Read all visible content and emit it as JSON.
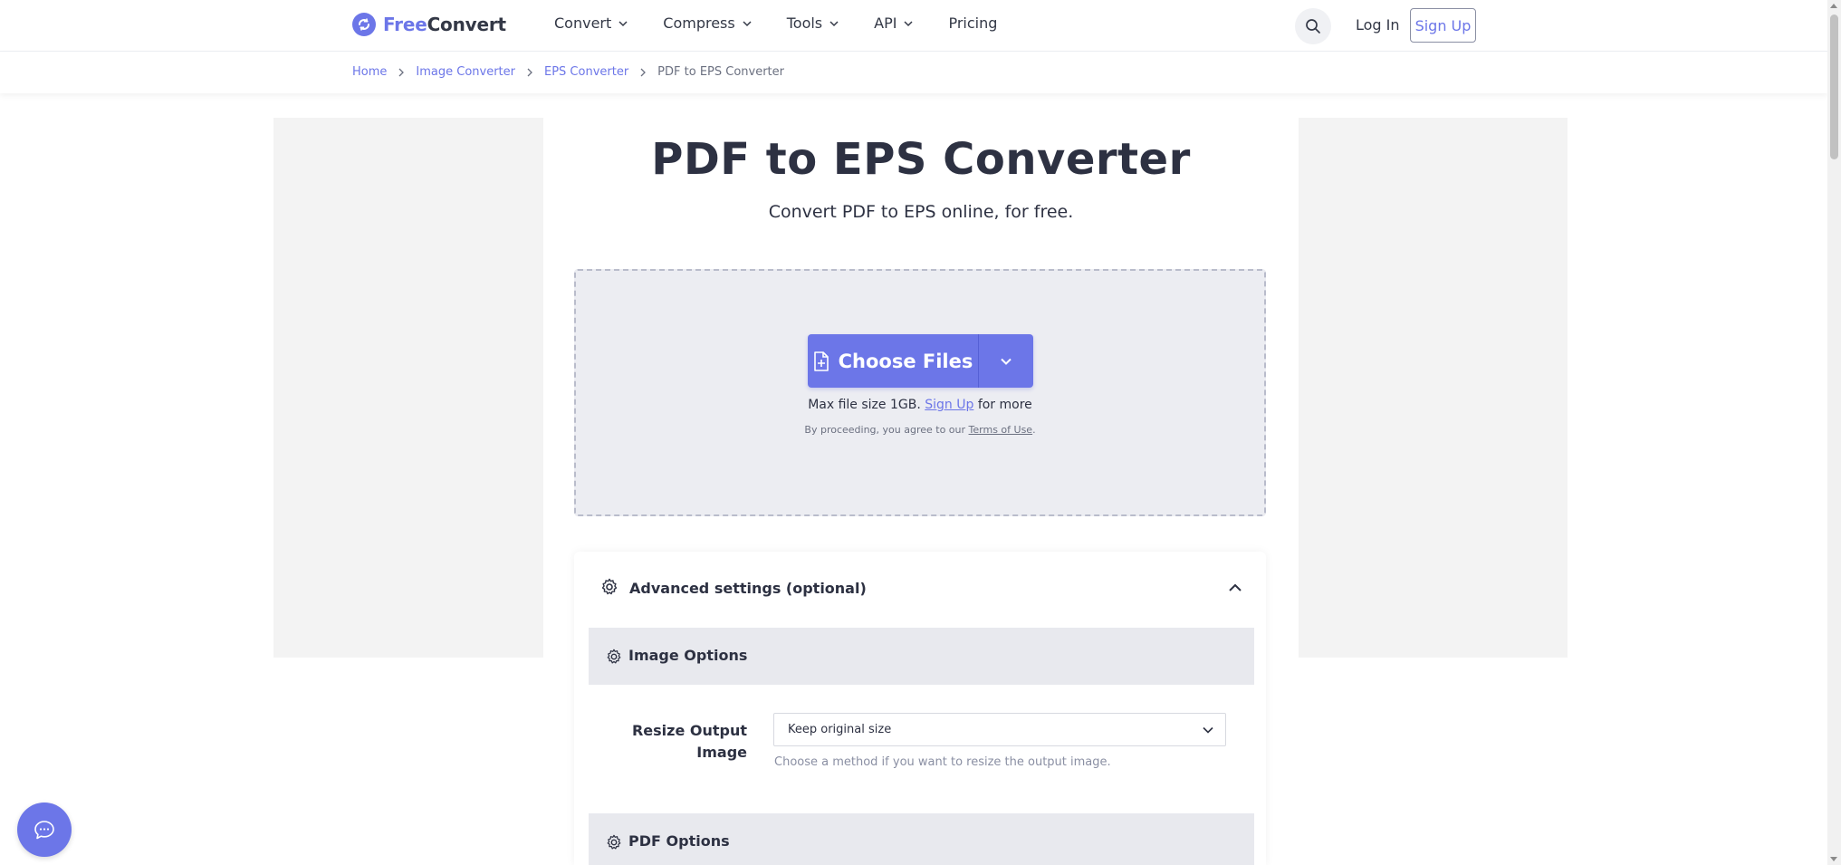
{
  "nav": {
    "logo_free": "Free",
    "logo_convert": "Convert",
    "items": [
      {
        "label": "Convert"
      },
      {
        "label": "Compress"
      },
      {
        "label": "Tools"
      },
      {
        "label": "API"
      },
      {
        "label": "Pricing"
      }
    ],
    "login_label": "Log In",
    "signup_label": "Sign Up"
  },
  "breadcrumb": {
    "items": [
      "Home",
      "Image Converter",
      "EPS Converter"
    ],
    "current": "PDF to EPS Converter"
  },
  "hero": {
    "title": "PDF to EPS Converter",
    "subtitle": "Convert PDF to EPS online, for free."
  },
  "upload": {
    "choose_label": "Choose Files",
    "max_size_prefix": "Max file size 1GB.",
    "signup_link": "Sign Up",
    "max_size_suffix": "for more",
    "terms_prefix": "By proceeding, you agree to our",
    "terms_link": "Terms of Use",
    "terms_suffix": "."
  },
  "advanced": {
    "title": "Advanced settings (optional)",
    "image_section": "Image Options",
    "resize_label": "Resize Output Image",
    "resize_value": "Keep original size",
    "resize_help": "Choose a method if you want to resize the output image.",
    "pdf_section": "PDF Options"
  },
  "colors": {
    "accent": "#6c76e8",
    "text": "#2d3142",
    "dropzone_bg": "#ecedf2",
    "section_bg": "#e8e9ee",
    "ad_bg": "#f3f3f3"
  },
  "icons": {
    "logo": "freeconvert-logo-icon",
    "search": "search-icon",
    "chevron": "chevron-down-icon",
    "file": "file-add-icon",
    "gear": "gear-icon",
    "collapse": "chevron-up-icon",
    "chat": "chat-bubble-icon"
  }
}
